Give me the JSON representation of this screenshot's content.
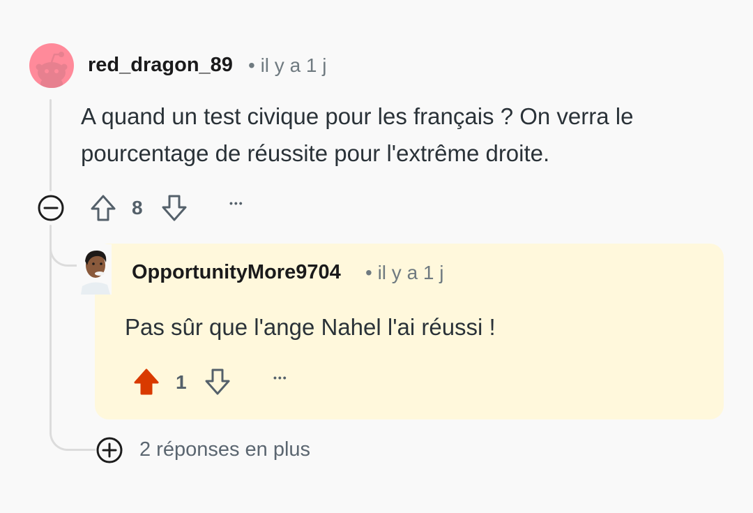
{
  "comment": {
    "username": "red_dragon_89",
    "meta": "• il y a 1 j",
    "body_line1": "A quand un test civique pour les français ? On verra le",
    "body_line2": "pourcentage de réussite pour l'extrême droite.",
    "score": "8",
    "more_dots": "•••",
    "avatar_color": "#ff8a9a"
  },
  "reply": {
    "username": "OpportunityMore9704",
    "meta": "• il y a 1 j",
    "body": "Pas sûr que l'ange Nahel l'ai réussi !",
    "score": "1",
    "more_dots": "•••",
    "highlight_color": "#fff8dc",
    "upvote_active_color": "#d93a00"
  },
  "more_replies": {
    "label": "2 réponses en plus"
  },
  "icons": {
    "collapse": "minus-circle-icon",
    "expand": "plus-circle-icon",
    "upvote": "arrow-up-icon",
    "downvote": "arrow-down-icon"
  }
}
